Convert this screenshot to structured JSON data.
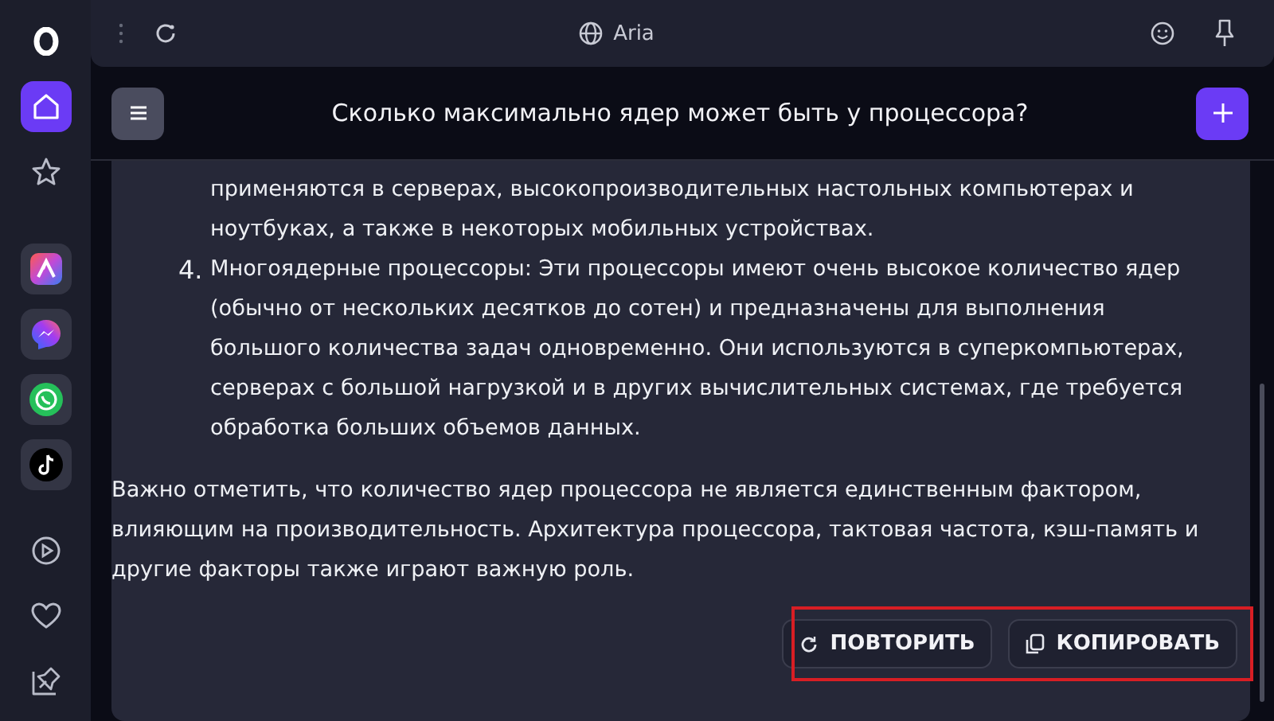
{
  "sidebar": {
    "items": [
      {
        "kind": "logo",
        "selected": false
      },
      {
        "kind": "home",
        "selected": true
      },
      {
        "kind": "star",
        "selected": false
      },
      {
        "kind": "aria-app",
        "selected": false
      },
      {
        "kind": "messenger",
        "selected": false
      },
      {
        "kind": "whatsapp",
        "selected": false
      },
      {
        "kind": "tiktok",
        "selected": false
      },
      {
        "kind": "player",
        "selected": false
      },
      {
        "kind": "heart",
        "selected": false
      },
      {
        "kind": "pin",
        "selected": false
      }
    ]
  },
  "address_bar": {
    "title": "Aria"
  },
  "chat": {
    "title": "Сколько максимально ядер может быть у процессора?"
  },
  "answer": {
    "continuation": "применяются в серверах, высокопроизводительных настольных компьютерах и ноутбуках, а также в некоторых мобильных устройствах.",
    "list_items": [
      {
        "number": "4.",
        "text": "Многоядерные процессоры: Эти процессоры имеют очень высокое количество ядер (обычно от нескольких десятков до сотен) и предназначены для выполнения большого количества задач одновременно. Они используются в суперкомпьютерах, серверах с большой нагрузкой и в других вычислительных системах, где требуется обработка больших объемов данных."
      }
    ],
    "paragraph": "Важно отметить, что количество ядер процессора не является единственным фактором, влияющим на производительность. Архитектура процессора, тактовая частота, кэш-память и другие факторы также играют важную роль."
  },
  "actions": {
    "highlighted": true,
    "buttons": [
      {
        "kind": "retry",
        "label": "ПОВТОРИТЬ"
      },
      {
        "kind": "copy",
        "label": "КОПИРОВАТЬ"
      }
    ]
  }
}
